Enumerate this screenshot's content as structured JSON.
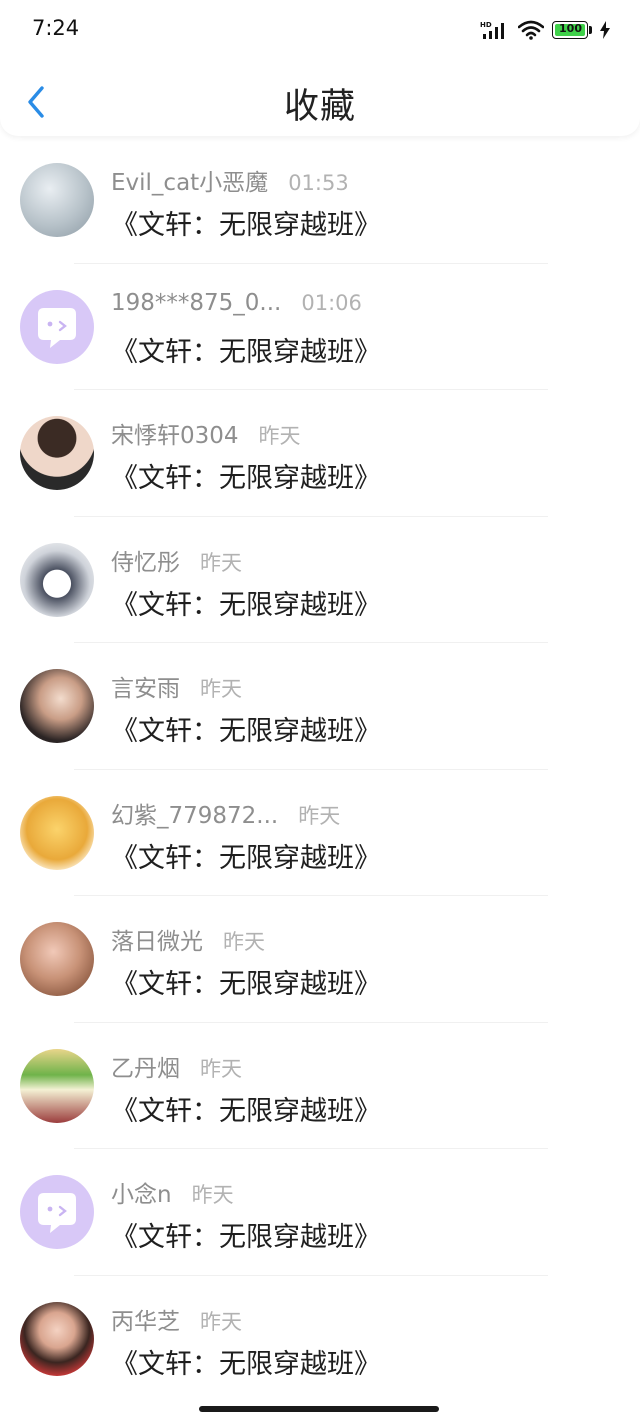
{
  "status_bar": {
    "time": "7:24",
    "battery": "100",
    "network": "HD"
  },
  "header": {
    "title": "收藏",
    "back_icon": "chevron-left-icon"
  },
  "colors": {
    "accent": "#2a8ce6",
    "avatar_placeholder": "#d8c8f7"
  },
  "items": [
    {
      "user": "Evil_cat小恶魔",
      "time": "01:53",
      "book": "《文轩：无限穿越班》",
      "avatar": "photo"
    },
    {
      "user": "198***875_0...",
      "time": "01:06",
      "book": "《文轩：无限穿越班》",
      "avatar": "placeholder"
    },
    {
      "user": "宋悸轩0304",
      "time": "昨天",
      "book": "《文轩：无限穿越班》",
      "avatar": "photo"
    },
    {
      "user": "侍忆彤",
      "time": "昨天",
      "book": "《文轩：无限穿越班》",
      "avatar": "photo"
    },
    {
      "user": "言安雨",
      "time": "昨天",
      "book": "《文轩：无限穿越班》",
      "avatar": "photo"
    },
    {
      "user": "幻紫_779872...",
      "time": "昨天",
      "book": "《文轩：无限穿越班》",
      "avatar": "photo"
    },
    {
      "user": "落日微光",
      "time": "昨天",
      "book": "《文轩：无限穿越班》",
      "avatar": "photo"
    },
    {
      "user": "乙丹烟",
      "time": "昨天",
      "book": "《文轩：无限穿越班》",
      "avatar": "photo"
    },
    {
      "user": "小念n",
      "time": "昨天",
      "book": "《文轩：无限穿越班》",
      "avatar": "placeholder"
    },
    {
      "user": "丙华芝",
      "time": "昨天",
      "book": "《文轩：无限穿越班》",
      "avatar": "photo"
    }
  ]
}
